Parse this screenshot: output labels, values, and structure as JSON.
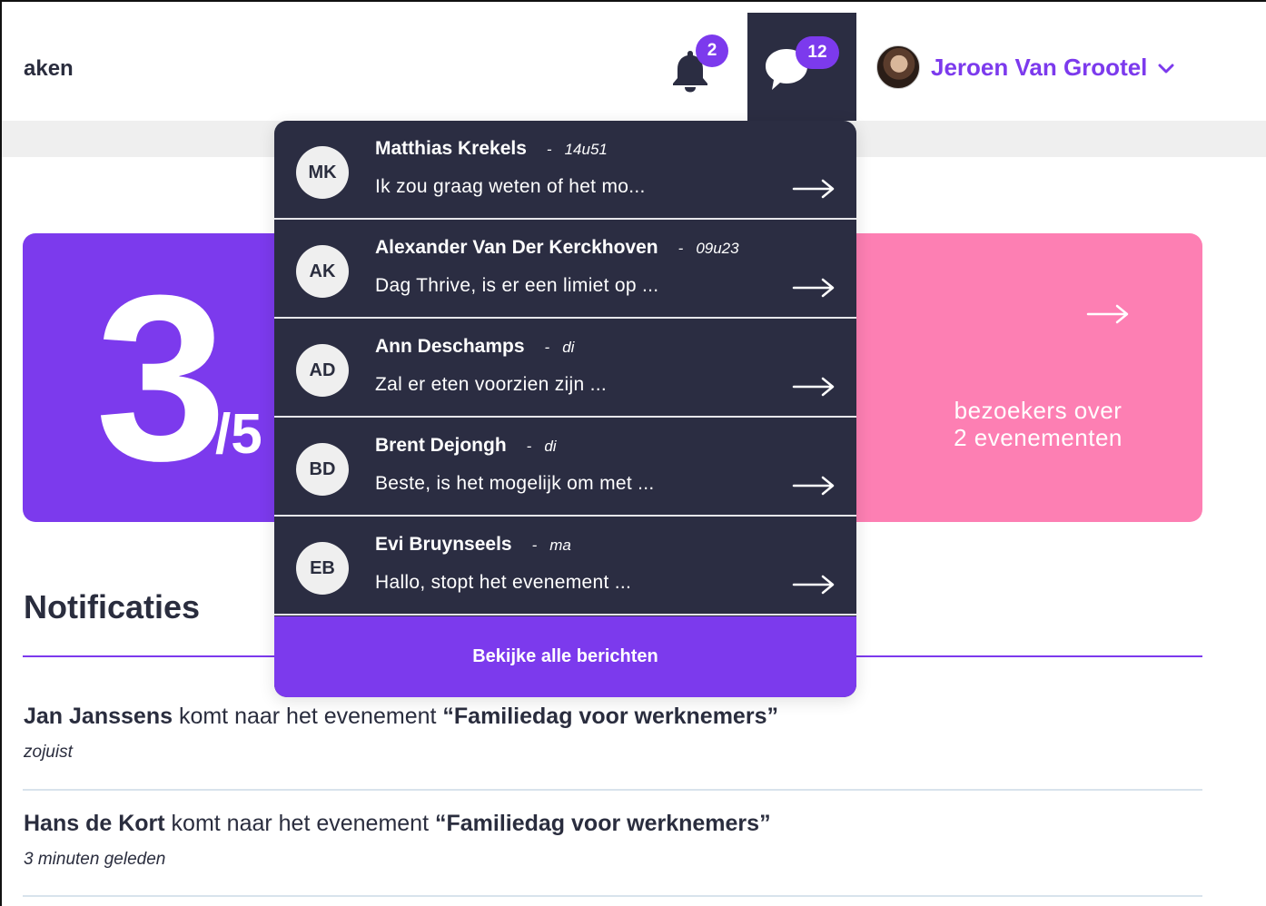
{
  "header": {
    "title": "aken",
    "notifications_count": "2",
    "messages_count": "12",
    "user_name": "Jeroen Van Grootel"
  },
  "stats": {
    "purple_card": {
      "number": "3",
      "denominator": "/5"
    },
    "pink_card": {
      "line1": "bezoekers over",
      "line2": "2 evenementen"
    }
  },
  "messages_dropdown": {
    "items": [
      {
        "initials": "MK",
        "name": "Matthias Krekels",
        "dash": "-",
        "time": "14u51",
        "preview": "Ik zou graag weten of het mo..."
      },
      {
        "initials": "AK",
        "name": "Alexander Van Der Kerckhoven",
        "dash": "-",
        "time": "09u23",
        "preview": "Dag Thrive, is er een limiet op ..."
      },
      {
        "initials": "AD",
        "name": "Ann Deschamps",
        "dash": "-",
        "time": "di",
        "preview": "Zal er eten voorzien zijn ..."
      },
      {
        "initials": "BD",
        "name": "Brent Dejongh",
        "dash": "-",
        "time": "di",
        "preview": "Beste, is het mogelijk om met ..."
      },
      {
        "initials": "EB",
        "name": "Evi Bruynseels",
        "dash": "-",
        "time": "ma",
        "preview": "Hallo, stopt het evenement ..."
      }
    ],
    "footer_label": "Bekijke alle berichten"
  },
  "notifications": {
    "title": "Notificaties",
    "items": [
      {
        "person": "Jan Janssens",
        "action": " komt naar het evenement ",
        "event": "“Familiedag voor werknemers”",
        "time": "zojuist"
      },
      {
        "person": "Hans de Kort",
        "action": " komt naar het evenement ",
        "event": "“Familiedag voor werknemers”",
        "time": "3 minuten geleden"
      }
    ]
  },
  "colors": {
    "accent": "#7c3aed",
    "dark": "#2b2d42",
    "pink": "#fd7fb3",
    "gray_band": "#efefef"
  }
}
